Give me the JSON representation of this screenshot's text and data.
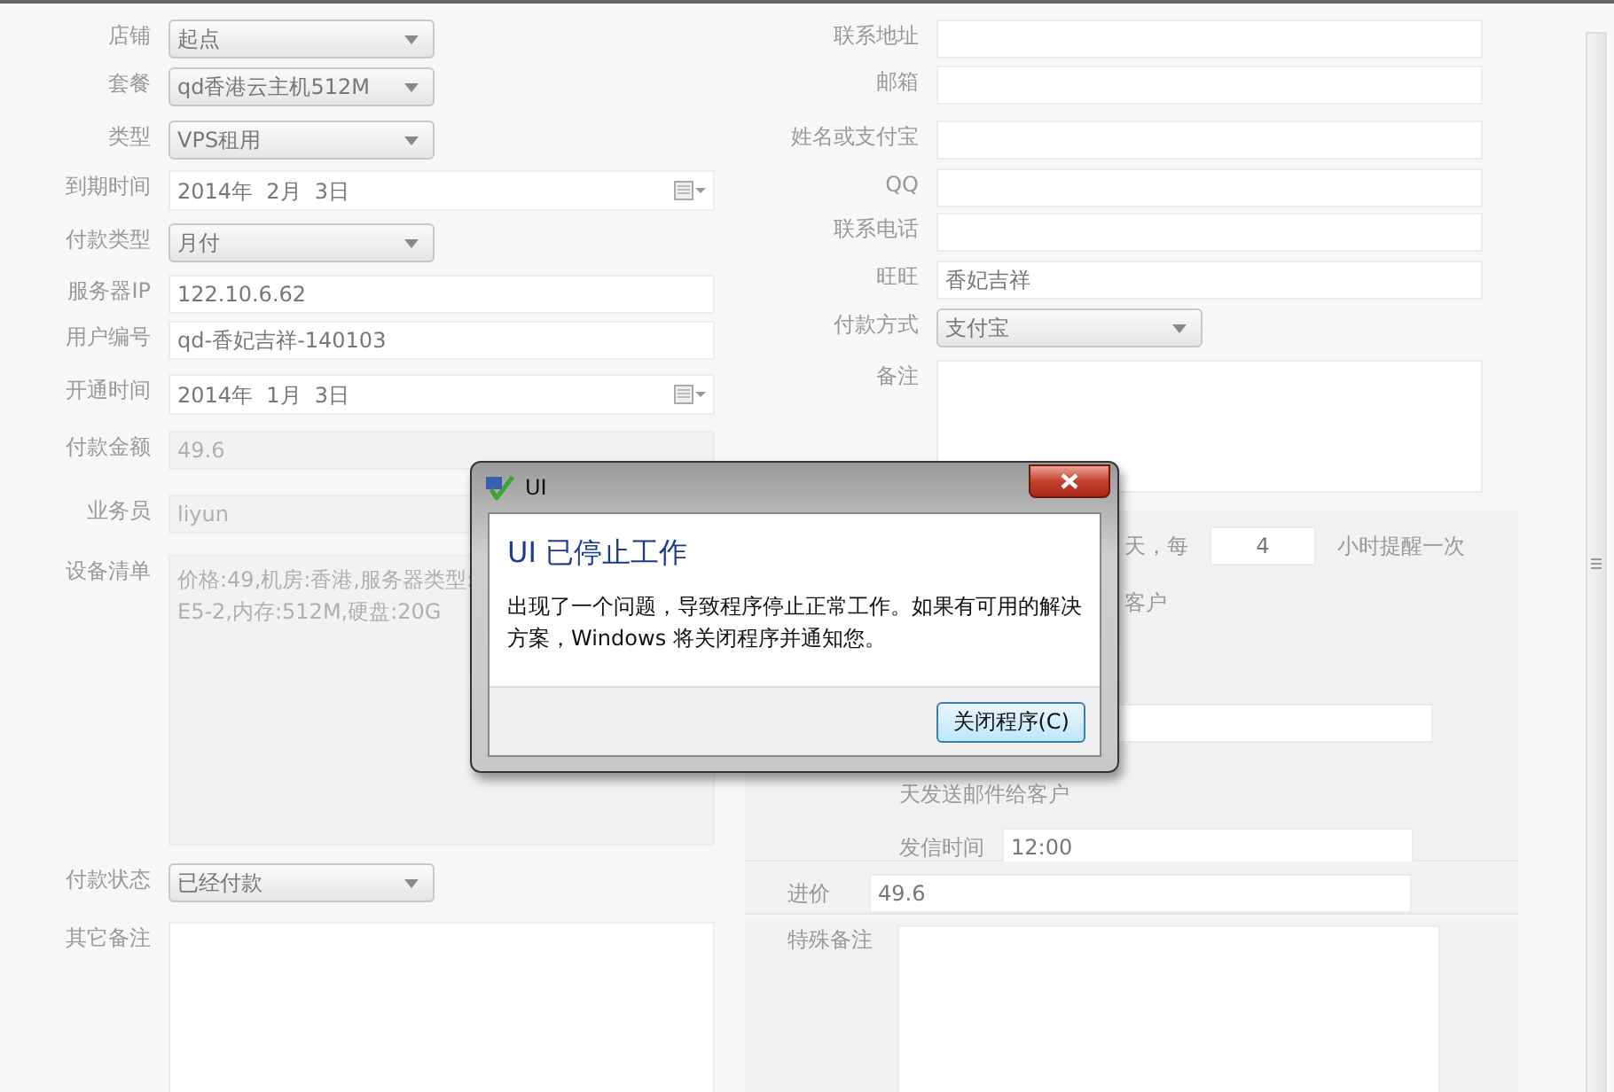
{
  "left_fields": [
    {
      "label": "店铺",
      "kind": "select",
      "value": "起点",
      "disabled": false
    },
    {
      "label": "套餐",
      "kind": "select",
      "value": "qd香港云主机512M",
      "disabled": false
    },
    {
      "label": "类型",
      "kind": "select",
      "value": "VPS租用",
      "disabled": false
    },
    {
      "label": "到期时间",
      "kind": "date",
      "value": "2014年  2月  3日",
      "disabled": false
    },
    {
      "label": "付款类型",
      "kind": "select",
      "value": "月付",
      "disabled": false
    },
    {
      "label": "服务器IP",
      "kind": "input",
      "value": "122.10.6.62",
      "disabled": false
    },
    {
      "label": "用户编号",
      "kind": "input",
      "value": "qd-香妃吉祥-140103",
      "disabled": false
    },
    {
      "label": "开通时间",
      "kind": "date",
      "value": "2014年  1月  3日",
      "disabled": false
    },
    {
      "label": "付款金额",
      "kind": "input",
      "value": "49.6",
      "disabled": true
    },
    {
      "label": "业务员",
      "kind": "input",
      "value": "liyun",
      "disabled": true
    },
    {
      "label": "设备清单",
      "kind": "textarea",
      "value": "价格:49,机房:香港,服务器类型:\nE5-2,内存:512M,硬盘:20G",
      "disabled": true
    },
    {
      "label": "付款状态",
      "kind": "select",
      "value": "已经付款",
      "disabled": false
    },
    {
      "label": "其它备注",
      "kind": "textarea",
      "disabled": false
    }
  ],
  "right_fields": [
    {
      "label": "联系地址",
      "kind": "input"
    },
    {
      "label": "邮箱",
      "kind": "input"
    },
    {
      "label": "姓名或支付宝",
      "kind": "input"
    },
    {
      "label": "QQ",
      "kind": "input"
    },
    {
      "label": "联系电话",
      "kind": "input"
    },
    {
      "label": "旺旺",
      "kind": "input",
      "value": "香妃吉祥"
    },
    {
      "label": "付款方式",
      "kind": "select",
      "value": "支付宝"
    },
    {
      "label": "备注",
      "kind": "textarea"
    }
  ],
  "reminder": {
    "days_text": "天，每",
    "hours_value": "4",
    "hours_text": "小时提醒一次",
    "notify_text": "客户",
    "email_text": "天发送邮件给客户",
    "send_time_label": "发信时间",
    "send_time_value": "12:00"
  },
  "purchase_price": {
    "label": "进价",
    "value": "49.6"
  },
  "special_note": {
    "label": "特殊备注"
  },
  "dialog": {
    "title": "UI",
    "heading": "UI 已停止工作",
    "message": "出现了一个问题，导致程序停止正常工作。如果有可用的解决方案，Windows 将关闭程序并通知您。",
    "button": "关闭程序(C)"
  }
}
